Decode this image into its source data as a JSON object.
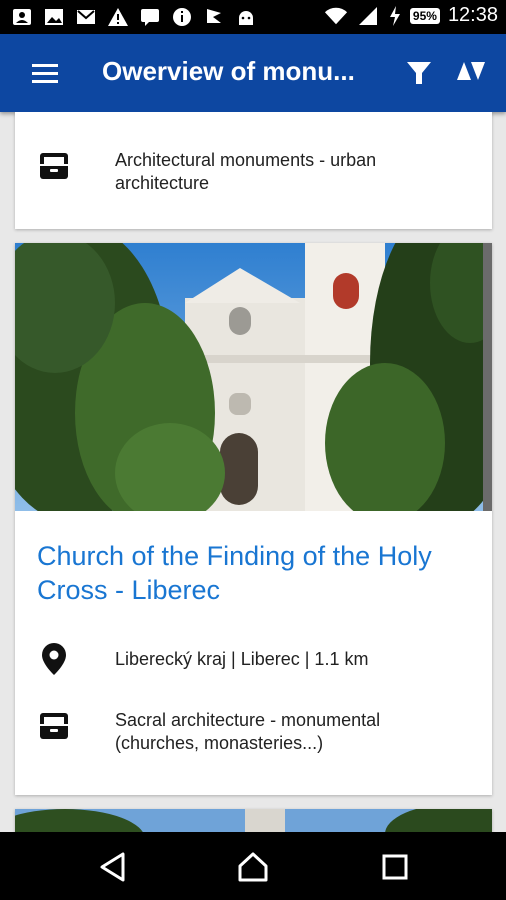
{
  "status_bar": {
    "battery": "95%",
    "time": "12:38"
  },
  "app_bar": {
    "title": "Owerview of monu...",
    "icons": [
      "menu-icon",
      "filter-icon",
      "sort-icon"
    ]
  },
  "cards": [
    {
      "category": "Architectural monuments - urban architecture"
    },
    {
      "title": "Church of the Finding of the Holy Cross - Liberec",
      "location": "Liberecký kraj | Liberec | 1.1 km",
      "category": "Sacral architecture - monumental (churches, monasteries...)"
    }
  ],
  "colors": {
    "app_bar": "#0d47a1",
    "title_link": "#1976d2"
  }
}
